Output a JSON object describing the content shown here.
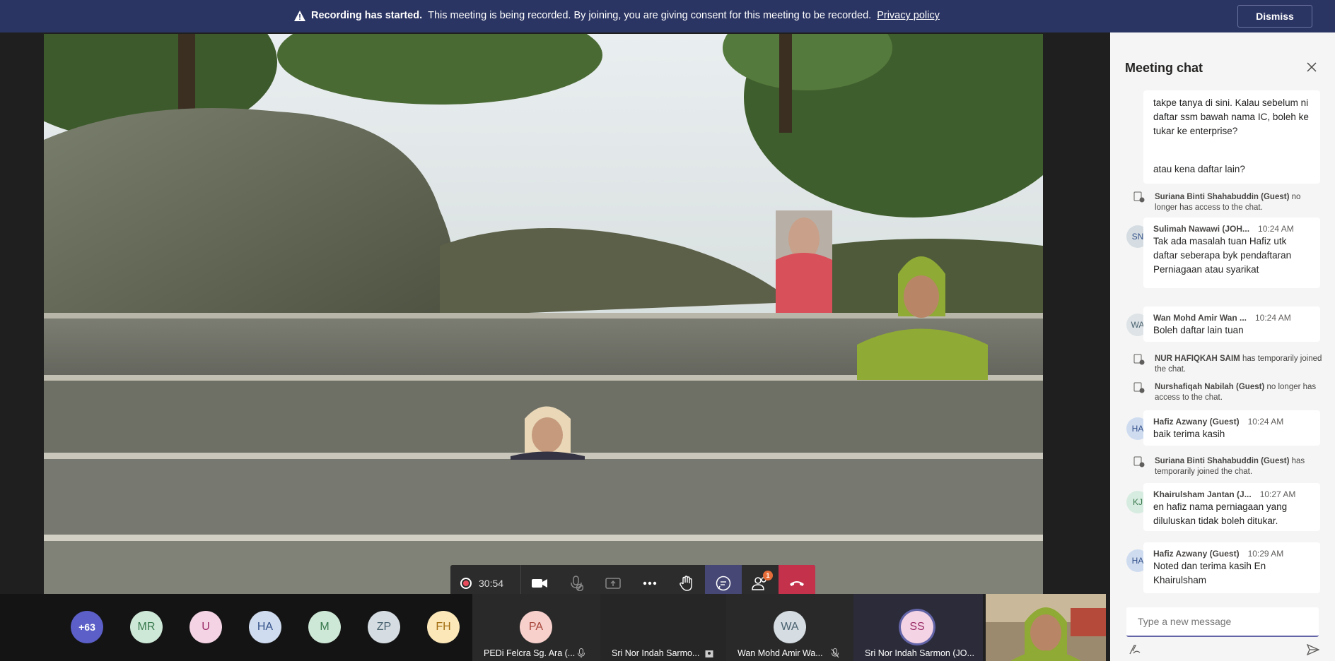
{
  "banner": {
    "bold": "Recording has started.",
    "text": "This meeting is being recorded. By joining, you are giving consent for this meeting to be recorded.",
    "link": "Privacy policy",
    "dismiss": "Dismiss"
  },
  "controls": {
    "timer": "30:54",
    "people_badge": "1"
  },
  "participants": {
    "overflow": "+63",
    "avatars": [
      "MR",
      "U",
      "HA",
      "M",
      "ZP",
      "FH"
    ],
    "tiles": [
      {
        "initials": "PA",
        "name": "PEDi Felcra Sg. Ara (..."
      },
      {
        "initials": "",
        "name": "Sri Nor Indah Sarmo..."
      },
      {
        "initials": "WA",
        "name": "Wan Mohd Amir Wa..."
      },
      {
        "initials": "SS",
        "name": "Sri Nor Indah Sarmon (JO..."
      }
    ]
  },
  "chat": {
    "title": "Meeting chat",
    "messages": [
      {
        "text": "takpe tanya di sini. Kalau sebelum ni daftar ssm bawah nama IC, boleh ke tukar ke enterprise?"
      },
      {
        "text": "atau kena daftar lain?"
      },
      {
        "system_name": "Suriana Binti Shahabuddin (Guest)",
        "system_text": "no longer has access to the chat."
      },
      {
        "initials": "SN",
        "sender": "Sulimah Nawawi (JOH...",
        "time": "10:24 AM",
        "text": "Tak ada masalah tuan Hafiz utk daftar seberapa byk pendaftaran Perniagaan atau syarikat"
      },
      {
        "initials": "WA",
        "sender": "Wan Mohd Amir Wan ...",
        "time": "10:24 AM",
        "text": "Boleh daftar lain tuan"
      },
      {
        "system_name": "NUR HAFIQKAH SAIM",
        "system_text": "has temporarily joined the chat."
      },
      {
        "system_name": "Nurshafiqah Nabilah (Guest)",
        "system_text": "no longer has access to the chat."
      },
      {
        "initials": "HA",
        "sender": "Hafiz Azwany (Guest)",
        "time": "10:24 AM",
        "text": "baik terima kasih"
      },
      {
        "system_name": "Suriana Binti Shahabuddin (Guest)",
        "system_text": "has temporarily joined the chat."
      },
      {
        "initials": "KJ",
        "sender": "Khairulsham Jantan (J...",
        "time": "10:27 AM",
        "text": "en hafiz nama perniagaan yang diluluskan tidak boleh ditukar."
      },
      {
        "initials": "HA",
        "sender": "Hafiz Azwany (Guest)",
        "time": "10:29 AM",
        "text": "Noted dan terima kasih En Khairulsham"
      }
    ],
    "compose_placeholder": "Type a new message"
  }
}
